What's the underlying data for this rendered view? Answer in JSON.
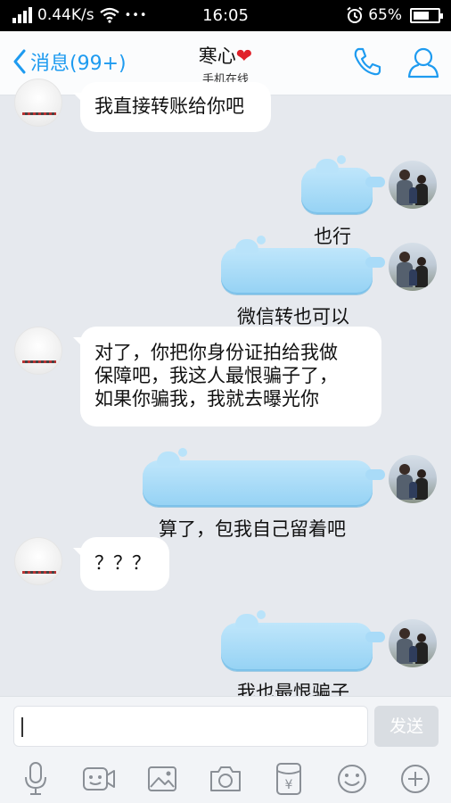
{
  "status_bar": {
    "speed": "0.44K/s",
    "more": "•••",
    "time": "16:05",
    "battery": "65%",
    "battery_level": 0.65
  },
  "header": {
    "back_label": "消息(99+)",
    "contact_name": "寒心",
    "heart": "❤",
    "status": "手机在线",
    "call_icon": "phone-icon",
    "profile_icon": "person-icon"
  },
  "messages": [
    {
      "from": "other",
      "text": "我直接转账给你吧"
    },
    {
      "from": "me",
      "text": "也行"
    },
    {
      "from": "me",
      "text": "微信转也可以"
    },
    {
      "from": "other",
      "text": "对了，你把你身份证拍给我做\n保障吧，我这人最恨骗子了，\n如果你骗我，我就去曝光你"
    },
    {
      "from": "me",
      "text": "算了，包我自己留着吧"
    },
    {
      "from": "other",
      "text": "？？？"
    },
    {
      "from": "me",
      "text": "我也最恨骗子"
    }
  ],
  "composer": {
    "placeholder": "",
    "send_label": "发送"
  },
  "toolbar": {
    "items": [
      "microphone-icon",
      "video-icon",
      "image-icon",
      "camera-icon",
      "red-packet-icon",
      "emoji-icon",
      "plus-icon"
    ],
    "red_packet_symbol": "¥"
  },
  "colors": {
    "accent": "#1e9bf0",
    "outgoing_bubble": "#a9dbf8",
    "incoming_bubble": "#ffffff",
    "background": "#e6e9ee"
  }
}
